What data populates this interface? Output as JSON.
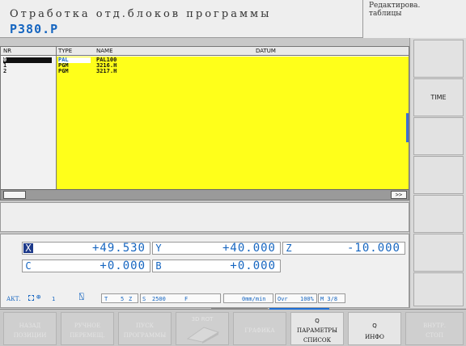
{
  "header": {
    "mode_title": "Отработка отд.блоков программы",
    "program_name": "Р380.Р",
    "mode_box_line1": "Редактирова.",
    "mode_box_line2": "таблицы"
  },
  "table": {
    "columns": {
      "nr": "NR",
      "type": "TYPE",
      "name": "NAME",
      "datum": "DATUM"
    },
    "rows": [
      {
        "nr": "0",
        "type": "PAL",
        "name": "PAL100"
      },
      {
        "nr": "1",
        "type": "PGM",
        "name": "3216.H"
      },
      {
        "nr": "2",
        "type": "PGM",
        "name": "3217.H"
      }
    ],
    "scroll_right_label": ">>"
  },
  "positions": {
    "x": {
      "axis": "X",
      "value": "+49.530"
    },
    "y": {
      "axis": "Y",
      "value": "+40.000"
    },
    "z": {
      "axis": "Z",
      "value": "-10.000"
    },
    "c": {
      "axis": "C",
      "value": "+0.000"
    },
    "b": {
      "axis": "B",
      "value": "+0.000"
    }
  },
  "status": {
    "mode": "АКТ.",
    "datum_number": "1",
    "tool_label": "T",
    "tool_axis_value": "5",
    "tool_axis": "Z",
    "spindle_label": "S",
    "spindle_speed": "2500",
    "feed_label": "F",
    "feed_value": "0mm/min",
    "override_label": "Ovr",
    "override_value": "100%",
    "m_functions": "M 3/8"
  },
  "right_softkeys": [
    {
      "label": ""
    },
    {
      "label": "TIME"
    },
    {
      "label": ""
    },
    {
      "label": ""
    },
    {
      "label": ""
    },
    {
      "label": ""
    },
    {
      "label": ""
    }
  ],
  "bottom_softkeys": [
    {
      "line1": "НАЗАД",
      "line2": "ПОЗИЦИИ",
      "enabled": false
    },
    {
      "line1": "РУЧНОЕ",
      "line2": "ПЕРЕМЕЩ.",
      "enabled": false
    },
    {
      "line1": "ПУСК",
      "line2": "ПРОГРАММЫ",
      "enabled": false
    },
    {
      "line1": "3D ROT",
      "line2": "",
      "enabled": false
    },
    {
      "line1": "ГРАФИКА",
      "line2": "",
      "enabled": false
    },
    {
      "line1": "Q",
      "line2": "ПАРАМЕТРЫ",
      "line3": "СПИСОК",
      "enabled": true
    },
    {
      "line1": "Q",
      "line2": "ИНФО",
      "enabled": true
    },
    {
      "line1": "ВНУТР.",
      "line2": "СТОП",
      "enabled": false
    }
  ]
}
